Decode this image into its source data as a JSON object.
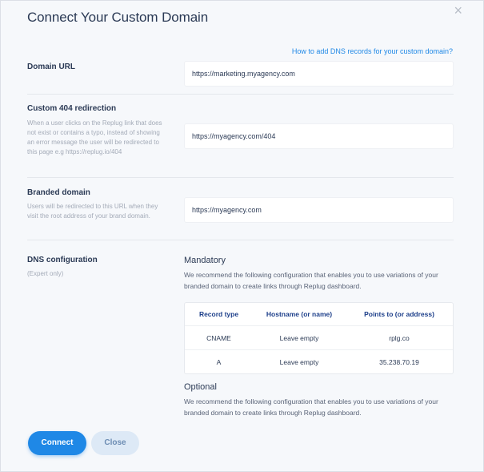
{
  "modal": {
    "title": "Connect Your Custom Domain",
    "close_symbol": "×",
    "dns_help_link": "How to add DNS records for your custom domain?"
  },
  "domain_url": {
    "label": "Domain URL",
    "value": "https://marketing.myagency.com"
  },
  "custom_404": {
    "label": "Custom 404 redirection",
    "hint": "When a user clicks on the Replug link that does not exist or contains a typo, instead of showing an error message the user will be redirected to this page e.g https://replug.io/404",
    "value": "https://myagency.com/404"
  },
  "branded_domain": {
    "label": "Branded domain",
    "hint": "Users will be redirected to this URL when they visit the root address of your brand domain.",
    "value": "https://myagency.com"
  },
  "dns": {
    "label": "DNS configuration",
    "hint": "(Expert only)",
    "mandatory_title": "Mandatory",
    "mandatory_text": "We recommend the following configuration that enables you to use variations of your branded domain to create links through Replug dashboard.",
    "table": {
      "headers": [
        "Record type",
        "Hostname (or name)",
        "Points to (or address)"
      ],
      "rows": [
        [
          "CNAME",
          "Leave empty",
          "rplg.co"
        ],
        [
          "A",
          "Leave empty",
          "35.238.70.19"
        ]
      ]
    },
    "optional_title": "Optional",
    "optional_text": "We recommend the following configuration that enables you to use variations of your branded domain to create links through Replug dashboard."
  },
  "buttons": {
    "connect": "Connect",
    "close": "Close"
  },
  "colors": {
    "accent": "#1f88e6",
    "title": "#2b3a55",
    "table_header": "#1d3f8a",
    "background": "#f6f8fb"
  }
}
